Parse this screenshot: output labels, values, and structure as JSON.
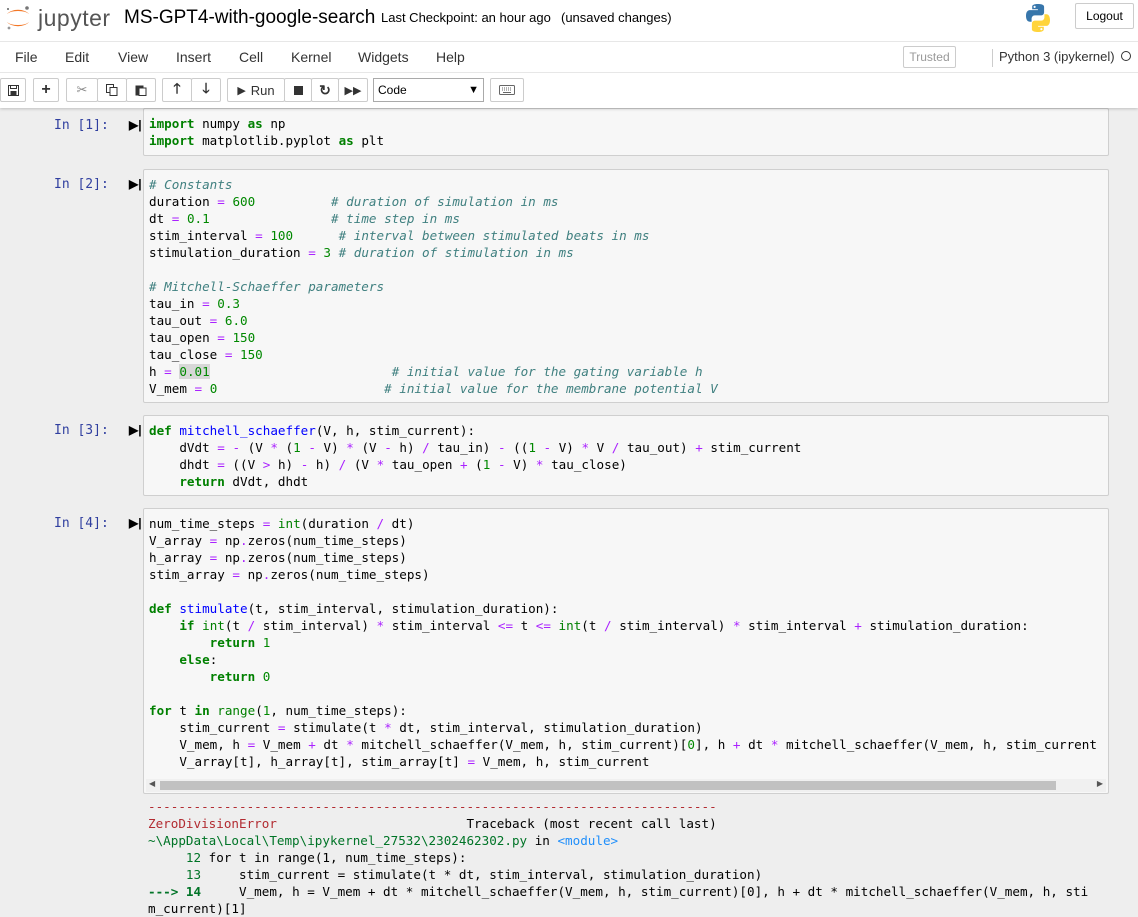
{
  "header": {
    "logo_text": "jupyter",
    "notebook_title": "MS-GPT4-with-google-search",
    "checkpoint": "Last Checkpoint: an hour ago",
    "unsaved": "(unsaved changes)",
    "logout_label": "Logout"
  },
  "menu": {
    "items": [
      "File",
      "Edit",
      "View",
      "Insert",
      "Cell",
      "Kernel",
      "Widgets",
      "Help"
    ],
    "trusted": "Trusted",
    "kernel": "Python 3 (ipykernel)"
  },
  "toolbar": {
    "run_label": "Run",
    "cell_type": "Code",
    "icons": [
      "save-icon",
      "plus-icon",
      "cut-icon",
      "copy-icon",
      "paste-icon",
      "arrow-up-icon",
      "arrow-down-icon",
      "run-icon",
      "stop-icon",
      "restart-icon",
      "fast-forward-icon",
      "keyboard-icon"
    ]
  },
  "cells": [
    {
      "prompt": "In [1]:",
      "lines": [
        "import numpy as np",
        "import matplotlib.pyplot as plt"
      ]
    },
    {
      "prompt": "In [2]:",
      "lines": [
        "# Constants",
        "duration = 600          # duration of simulation in ms",
        "dt = 0.1                # time step in ms",
        "stim_interval = 100      # interval between stimulated beats in ms",
        "stimulation_duration = 3 # duration of stimulation in ms",
        "",
        "# Mitchell-Schaeffer parameters",
        "tau_in = 0.3",
        "tau_out = 6.0",
        "tau_open = 150",
        "tau_close = 150",
        "h = 0.01                        # initial value for the gating variable h",
        "V_mem = 0                      # initial value for the membrane potential V"
      ]
    },
    {
      "prompt": "In [3]:",
      "lines": [
        "def mitchell_schaeffer(V, h, stim_current):",
        "    dVdt = - (V * (1 - V) * (V - h) / tau_in) - ((1 - V) * V / tau_out) + stim_current",
        "    dhdt = ((V > h) - h) / (V * tau_open + (1 - V) * tau_close)",
        "    return dVdt, dhdt"
      ]
    },
    {
      "prompt": "In [4]:",
      "lines": [
        "num_time_steps = int(duration / dt)",
        "V_array = np.zeros(num_time_steps)",
        "h_array = np.zeros(num_time_steps)",
        "stim_array = np.zeros(num_time_steps)",
        "",
        "def stimulate(t, stim_interval, stimulation_duration):",
        "    if int(t / stim_interval) * stim_interval <= t <= int(t / stim_interval) * stim_interval + stimulation_duration:",
        "        return 1",
        "    else:",
        "        return 0",
        "",
        "for t in range(1, num_time_steps):",
        "    stim_current = stimulate(t * dt, stim_interval, stimulation_duration)",
        "    V_mem, h = V_mem + dt * mitchell_schaeffer(V_mem, h, stim_current)[0], h + dt * mitchell_schaeffer(V_mem, h, stim_current",
        "    V_array[t], h_array[t], stim_array[t] = V_mem, h, stim_current"
      ]
    }
  ],
  "traceback": {
    "dashes": "---------------------------------------------------------------------------",
    "error_name": "ZeroDivisionError",
    "header_right": "Traceback (most recent call last)",
    "file_path": "~\\AppData\\Local\\Temp\\ipykernel_27532\\2302462302.py",
    "in_word": " in ",
    "module": "<module>",
    "lines": [
      {
        "num": "     12 ",
        "text": "for t in range(1, num_time_steps):"
      },
      {
        "num": "     13 ",
        "text": "    stim_current = stimulate(t * dt, stim_interval, stimulation_duration)"
      },
      {
        "num": "---> 14 ",
        "text": "    V_mem, h = V_mem + dt * mitchell_schaeffer(V_mem, h, stim_current)[0], h + dt * mitchell_schaeffer(V_mem, h, sti"
      },
      {
        "num": "",
        "text": "m_current)[1]"
      }
    ]
  }
}
